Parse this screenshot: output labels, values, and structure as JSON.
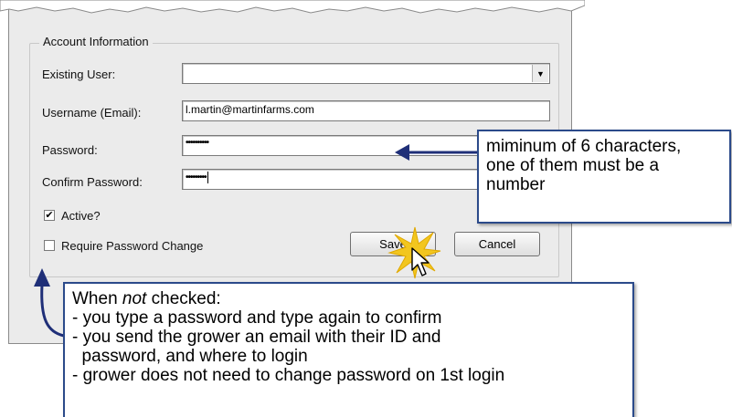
{
  "group": {
    "title": "Account Information"
  },
  "fields": {
    "existing_user": {
      "label": "Existing User:",
      "value": ""
    },
    "username": {
      "label": "Username (Email):",
      "value": "l.martin@martinfarms.com"
    },
    "password": {
      "label": "Password:",
      "value": "••••••••••"
    },
    "confirm_password": {
      "label": "Confirm Password:",
      "value": "•••••••••"
    }
  },
  "checkboxes": {
    "active": {
      "label": "Active?",
      "checked": true,
      "mark": "✔"
    },
    "require_change": {
      "label": "Require Password Change",
      "checked": false,
      "mark": ""
    }
  },
  "buttons": {
    "save": "Save",
    "cancel": "Cancel"
  },
  "callouts": {
    "password_rule": [
      "miminum of 6 characters,",
      "one of them must be a",
      "number"
    ],
    "not_checked": {
      "heading_pre": "When ",
      "heading_em": "not",
      "heading_post": " checked:",
      "lines": [
        "- you type a password and type again to confirm",
        "- you send the grower an email with their ID and",
        "  password, and where to login",
        "- grower does not need to change password on 1st login"
      ]
    }
  },
  "colors": {
    "callout_border": "#2b4a8a",
    "arrow": "#1f2f78",
    "burst": "#f2c61f",
    "dialog_bg": "#ebebeb"
  },
  "icons": {
    "dropdown": "chevron-down-icon",
    "cursor": "mouse-pointer-icon",
    "click": "click-burst-icon"
  }
}
